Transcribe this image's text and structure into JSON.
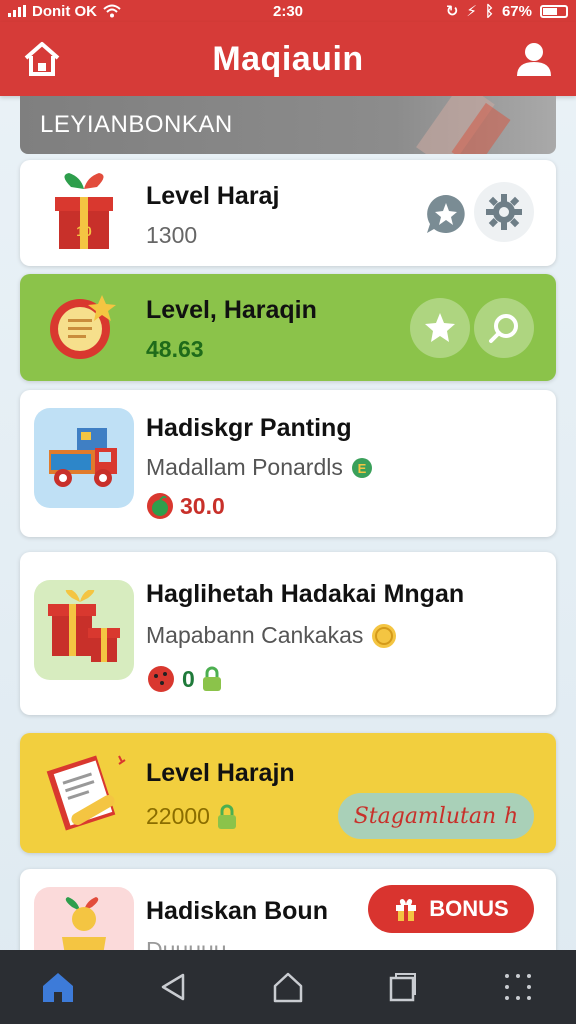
{
  "status_bar": {
    "carrier": "Donit OK",
    "time": "2:30",
    "battery": "67%"
  },
  "header": {
    "title": "Maqiauin",
    "home_icon": "home-icon",
    "profile_icon": "profile-icon"
  },
  "banner": {
    "label": "LEYIANBONKAN"
  },
  "cards": [
    {
      "title": "Level Haraj",
      "value": "1300",
      "icon": "gift-box-icon",
      "actions": [
        "chat-star-icon",
        "gear-icon"
      ],
      "bg": "#ffffff"
    },
    {
      "title": "Level, Haraqin",
      "value": "48.63",
      "icon": "document-badge-icon",
      "actions": [
        "star-icon",
        "search-icon"
      ],
      "bg": "#8bc34a"
    },
    {
      "title": "Hadiskgr Panting",
      "subtitle": "Madallam Ponardls",
      "value": "30.0",
      "icon": "toy-truck-icon",
      "bg": "#ffffff"
    },
    {
      "title": "Haglihetah Hadakai Mngan",
      "subtitle": "Mapabann Cankakas",
      "value": "0",
      "icon": "gift-stack-icon",
      "bg": "#ffffff"
    },
    {
      "title": "Level Harajn",
      "value": "22000",
      "button": "Stagamlutan",
      "icon": "certificate-icon",
      "bg": "#f2cf3e"
    },
    {
      "title": "Hadiskan Boun",
      "subtitle": "Duuuuu",
      "button": "BONUS",
      "icon": "coin-cup-icon",
      "bg": "#ffffff"
    }
  ],
  "colors": {
    "brand_red": "#d63b38",
    "green_card": "#8bc34a",
    "yellow_card": "#f2cf3e",
    "nav_active": "#3d7bd9"
  },
  "bottom_nav": [
    "home-icon",
    "back-icon",
    "home-outline-icon",
    "recents-icon",
    "menu-dots-icon"
  ]
}
